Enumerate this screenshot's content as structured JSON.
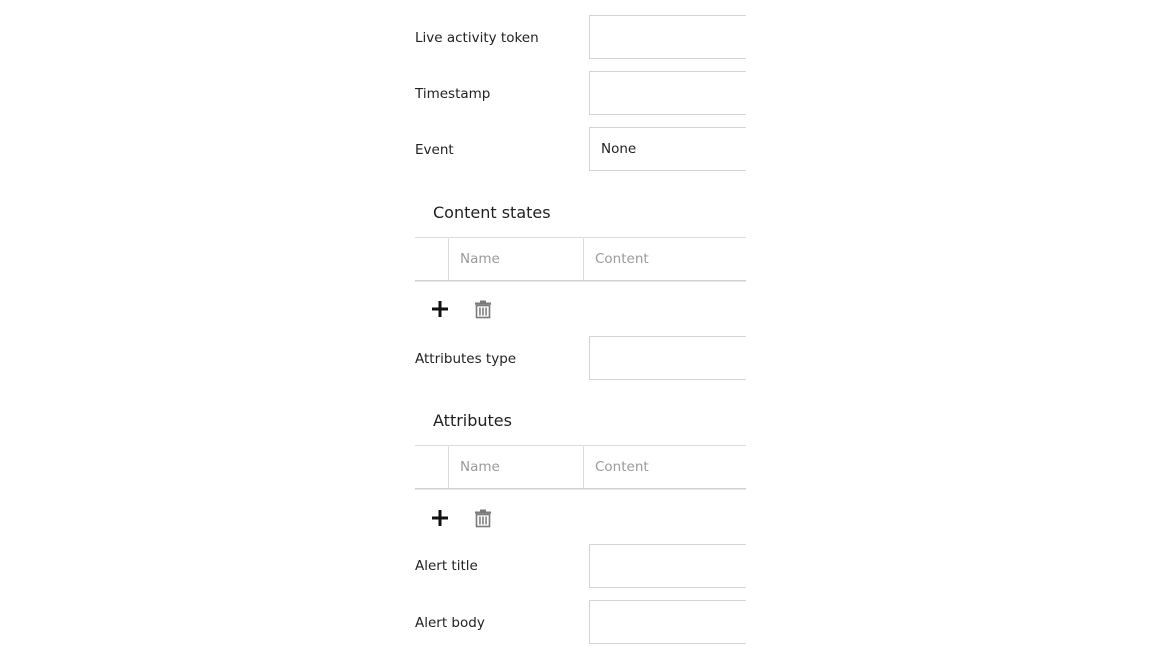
{
  "fields": {
    "live_activity_token": {
      "label": "Live activity token",
      "value": ""
    },
    "timestamp": {
      "label": "Timestamp",
      "value": ""
    },
    "event": {
      "label": "Event",
      "value": "None"
    },
    "attributes_type": {
      "label": "Attributes type",
      "value": ""
    },
    "alert_title": {
      "label": "Alert title",
      "value": ""
    },
    "alert_body": {
      "label": "Alert body",
      "value": ""
    }
  },
  "content_states": {
    "title": "Content states",
    "columns": [
      "Name",
      "Content"
    ],
    "rows": []
  },
  "attributes": {
    "title": "Attributes",
    "columns": [
      "Name",
      "Content"
    ],
    "rows": []
  },
  "icons": {
    "add": "plus-icon",
    "delete": "trash-icon"
  }
}
